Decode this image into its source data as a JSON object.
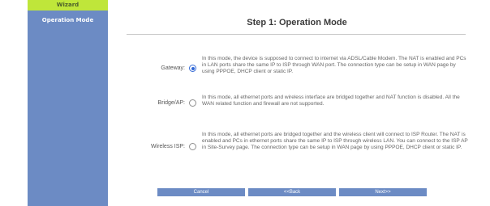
{
  "sidebar": {
    "items": [
      {
        "label": "Wizard",
        "active": true
      },
      {
        "label": "Operation Mode"
      }
    ]
  },
  "page": {
    "title": "Step 1: Operation Mode"
  },
  "options": [
    {
      "label": "Gateway:",
      "selected": true,
      "description": "In this mode, the device is supposed to connect to internet via ADSL/Cable Modem. The NAT is enabled and PCs in LAN ports share the same IP to ISP through WAN port. The connection type can be setup in WAN page by using PPPOE, DHCP client or static IP."
    },
    {
      "label": "Bridge/AP:",
      "selected": false,
      "description": "In this mode, all ethernet ports and wireless interface are bridged together and NAT function is disabled. All the WAN related function and firewall are not supported."
    },
    {
      "label": "Wireless ISP:",
      "selected": false,
      "description": "In this mode, all ethernet ports are bridged together and the wireless client will connect to ISP Router. The NAT is enabled and PCs in ethernet ports share the same IP to ISP through wireless LAN. You can connect to the ISP AP in Site-Survey page. The connection type can be setup in WAN page by using PPPOE, DHCP client or static IP."
    }
  ],
  "buttons": {
    "cancel": "Cancel",
    "back": "<<Back",
    "next": "Next>>"
  },
  "colors": {
    "sidebar_bg": "#6c8bc4",
    "wizard_highlight": "#bfe63a",
    "radio_selected": "#2e66d6"
  }
}
